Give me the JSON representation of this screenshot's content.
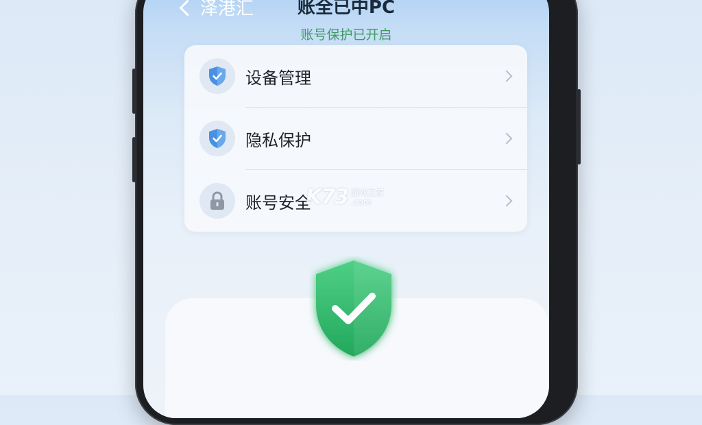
{
  "header": {
    "back_label": "泽港汇",
    "title": "账全已中PC",
    "subtitle": "账号保护已开启"
  },
  "settings": {
    "items": [
      {
        "label": "设备管理",
        "icon": "shield-check-icon"
      },
      {
        "label": "隐私保护",
        "icon": "shield-check-icon"
      },
      {
        "label": "账号安全",
        "icon": "lock-icon"
      }
    ]
  },
  "status": {
    "icon": "green-shield-check-icon"
  },
  "watermark": {
    "logo": "K73",
    "line1": "游戏之家",
    "line2": ".com"
  },
  "colors": {
    "accent_blue": "#4a90e2",
    "status_green": "#3f9a62",
    "shield_green": "#2fb86a"
  }
}
